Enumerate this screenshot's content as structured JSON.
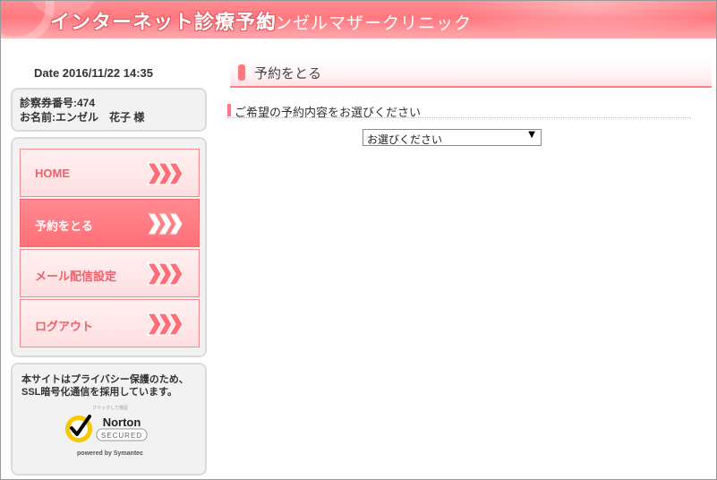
{
  "header": {
    "title": "インターネット診療予約",
    "clinic": "エンゼルマザークリニック"
  },
  "sidebar": {
    "date": "Date 2016/11/22 14:35",
    "user": {
      "card_number": "診察券番号:474",
      "name": "お名前:エンゼル　花子 様"
    },
    "menu": [
      {
        "label": "HOME",
        "active": false
      },
      {
        "label": "予約をとる",
        "active": true
      },
      {
        "label": "メール配信設定",
        "active": false
      },
      {
        "label": "ログアウト",
        "active": false
      }
    ],
    "ssl": {
      "line1": "本サイトはプライバシー保護のため、",
      "line2": "SSL暗号化通信を採用しています。",
      "badge_top": "クリックして検証",
      "badge_brand": "Norton",
      "badge_secured": "SECURED",
      "badge_powered": "powered by Symantec"
    }
  },
  "main": {
    "heading": "予約をとる",
    "subheading": "ご希望の予約内容をお選びください",
    "select_value": "お選びください"
  },
  "colors": {
    "accent": "#ff7880",
    "menu_text": "#f0606a",
    "norton_yellow": "#f7c800"
  }
}
